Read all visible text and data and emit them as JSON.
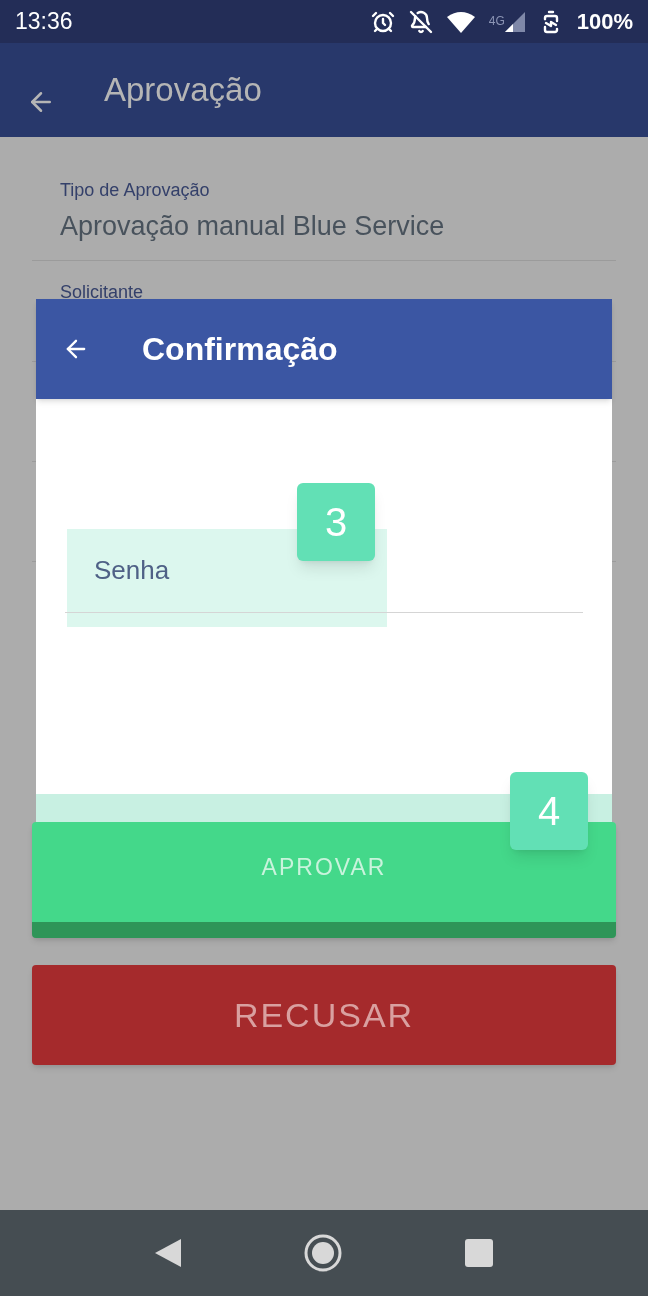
{
  "status_bar": {
    "time": "13:36",
    "network": "4G",
    "battery": "100%"
  },
  "app_bar": {
    "title": "Aprovação"
  },
  "fields": [
    {
      "label": "Tipo de Aprovação",
      "value": "Aprovação manual Blue Service"
    },
    {
      "label": "Solicitante"
    }
  ],
  "buttons": [
    {
      "label": "APROVAR",
      "kind": "approve"
    },
    {
      "label": "RECUSAR",
      "kind": "reject"
    }
  ],
  "dialog": {
    "title": "Confirmação",
    "password": {
      "placeholder": "Senha"
    }
  },
  "tutorial_steps": [
    {
      "number": "3"
    },
    {
      "number": "4"
    }
  ]
}
